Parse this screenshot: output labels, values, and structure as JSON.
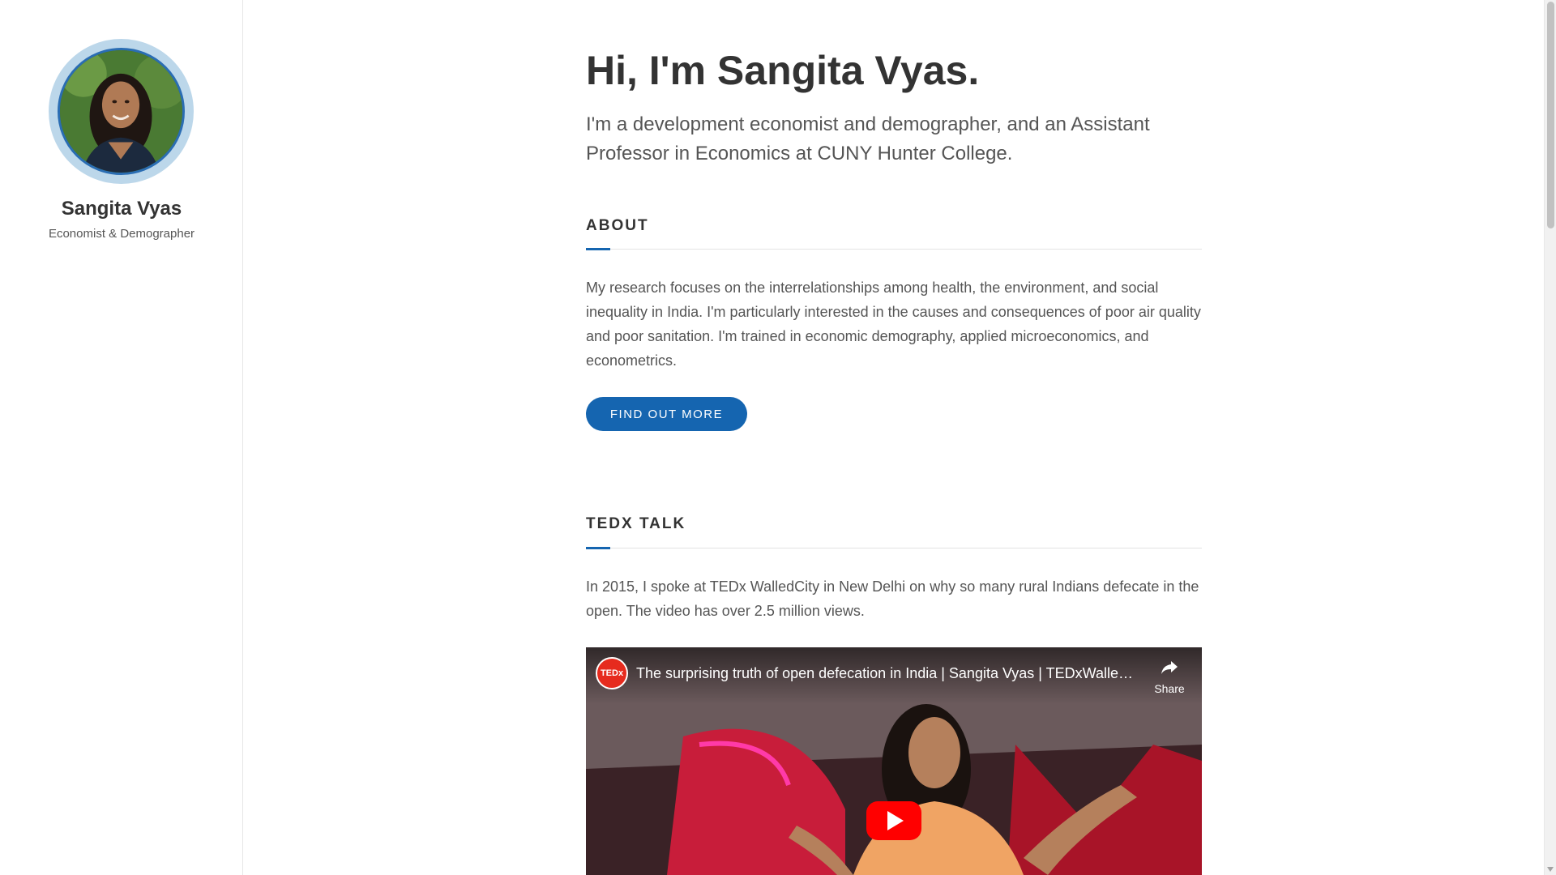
{
  "sidebar": {
    "name": "Sangita Vyas",
    "subtitle": "Economist & Demographer",
    "avatar_alt": "portrait"
  },
  "hero": {
    "title": "Hi, I'm Sangita Vyas.",
    "lead": "I'm a development economist and demographer, and an Assistant Professor in Economics at CUNY Hunter College."
  },
  "about": {
    "heading": "ABOUT",
    "body": "My research focuses on the interrelationships among health, the environment, and social inequality in India. I'm particularly interested in the causes and consequences of poor air quality and poor sanitation. I'm trained in economic demography, applied microeconomics, and econometrics.",
    "button_label": "FIND OUT MORE"
  },
  "tedx": {
    "heading": "TEDX TALK",
    "body": "In 2015, I spoke at TEDx WalledCity in New Delhi on why so many rural Indians defecate in the open. The video has over 2.5 million views.",
    "video": {
      "channel_logo": "TEDx",
      "title": "The surprising truth of open defecation in India | Sangita Vyas | TEDxWalledCity",
      "share_label": "Share"
    }
  },
  "colors": {
    "accent": "#1565b0",
    "text_dark": "#333333",
    "text_body": "#555555",
    "ted_red": "#e62b1e",
    "yt_red": "#ff0000"
  }
}
